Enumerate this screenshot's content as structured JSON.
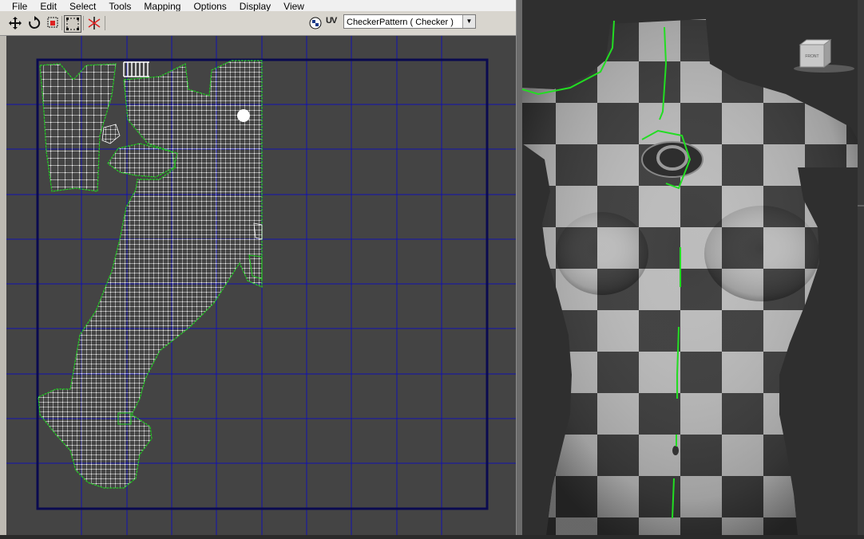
{
  "menu": {
    "file": "File",
    "edit": "Edit",
    "select": "Select",
    "tools": "Tools",
    "mapping": "Mapping",
    "options": "Options",
    "display": "Display",
    "view": "View"
  },
  "toolbar": {
    "tools": [
      "move-icon",
      "rotate-icon",
      "scale-icon",
      "freeform-icon",
      "mirror-icon"
    ],
    "uv_label": "UV",
    "map_dropdown": {
      "selected": "CheckerPattern  ( Checker )"
    }
  },
  "viewport": {
    "viewcube_label": "FRONT"
  },
  "colors": {
    "uv_background": "#444444",
    "grid": "#1010b0",
    "uv_border": "#0a0a5a",
    "uv_edges": "#ffffff",
    "seam": "#22dd22"
  }
}
